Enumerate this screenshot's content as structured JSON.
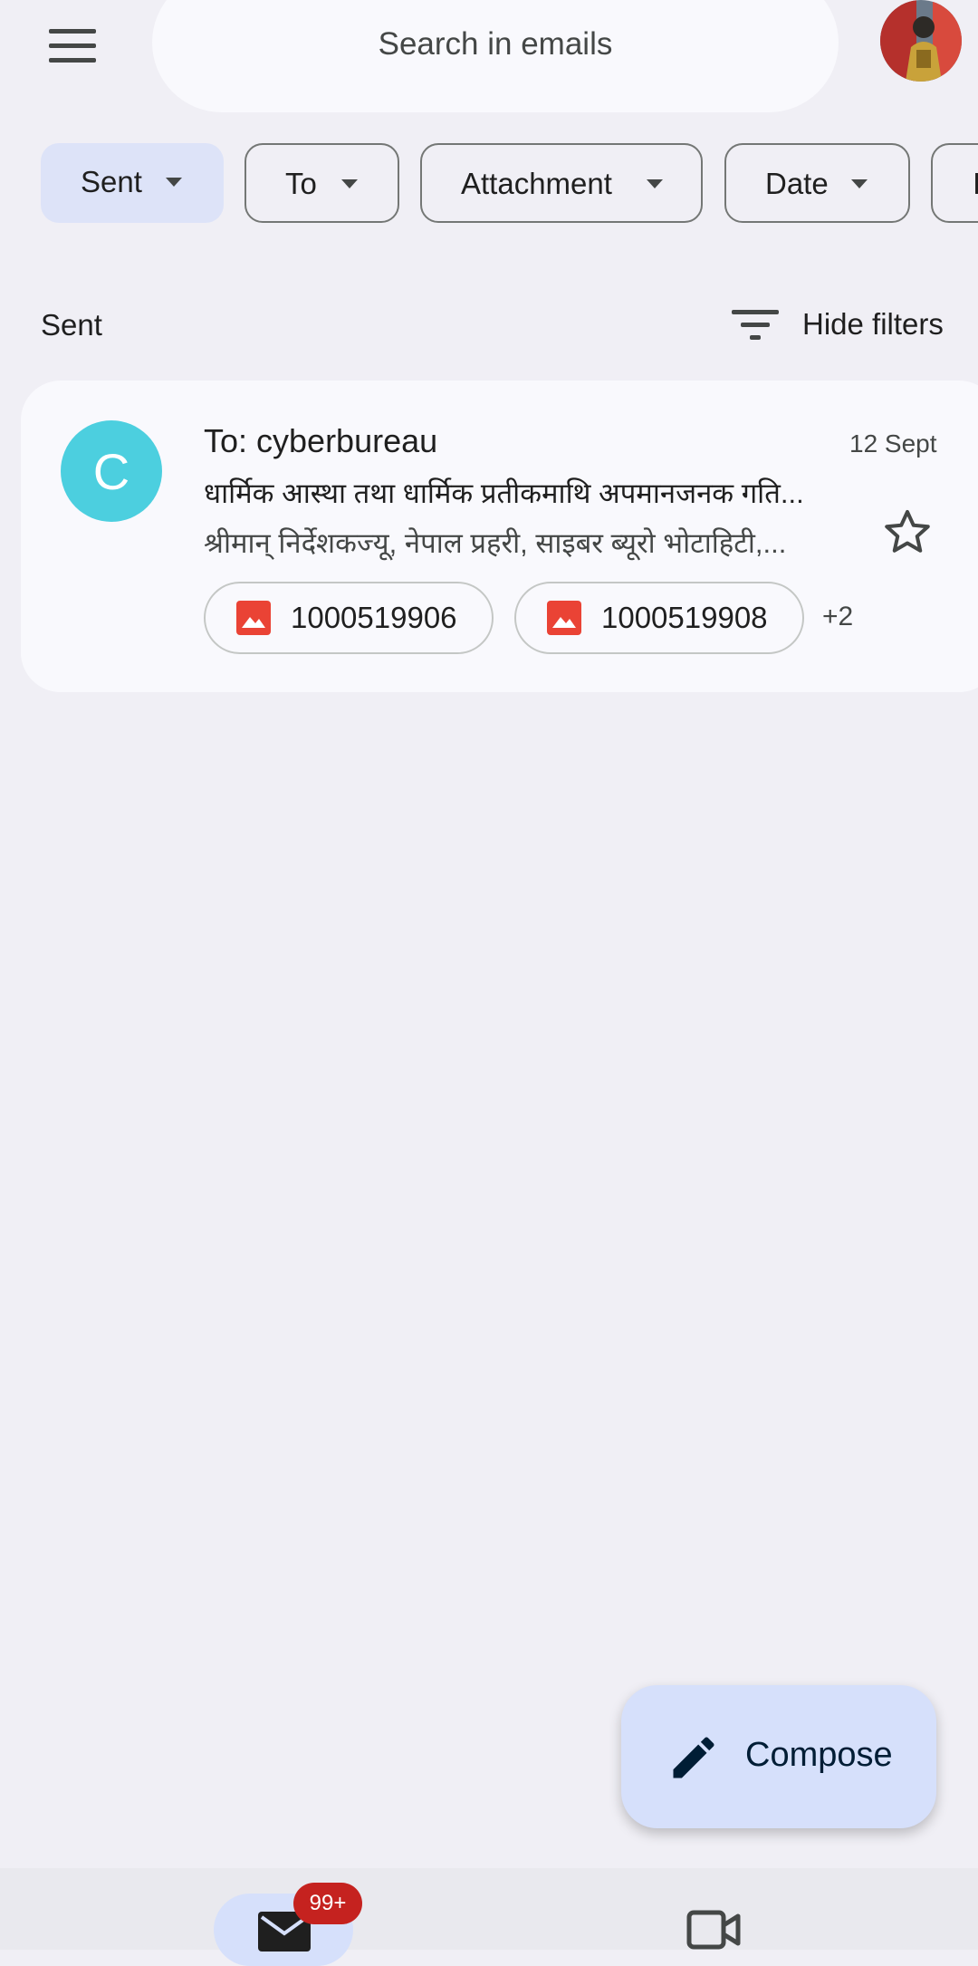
{
  "header": {
    "menu_icon": "hamburger-menu-icon",
    "search_placeholder": "Search in emails",
    "avatar_icon": "account-avatar"
  },
  "filter_chips": [
    {
      "label": "Sent",
      "active": true
    },
    {
      "label": "To",
      "active": false
    },
    {
      "label": "Attachment",
      "active": false
    },
    {
      "label": "Date",
      "active": false
    },
    {
      "label": "I",
      "active": false
    }
  ],
  "section": {
    "label": "Sent",
    "hide_filters_label": "Hide filters"
  },
  "emails": [
    {
      "avatar_letter": "C",
      "avatar_color": "#4ccfdf",
      "to": "To: cyberbureau",
      "date": "12 Sept",
      "subject": "धार्मिक आस्था तथा धार्मिक प्रतीकमाथि अपमानजनक गति...",
      "snippet": "श्रीमान् निर्देशकज्यू, नेपाल प्रहरी, साइबर ब्यूरो भोटाहिटी,...",
      "attachments": [
        "1000519906",
        "1000519908"
      ],
      "more_attachments": "+2",
      "starred": false
    }
  ],
  "compose": {
    "label": "Compose"
  },
  "bottom_nav": {
    "mail_badge": "99+",
    "items": [
      "mail-icon",
      "video-icon"
    ]
  },
  "colors": {
    "background": "#f0eff5",
    "active_chip": "#dde3f8",
    "fab": "#d6e0fb",
    "badge": "#c5221f",
    "attachment_icon": "#ea4335"
  }
}
